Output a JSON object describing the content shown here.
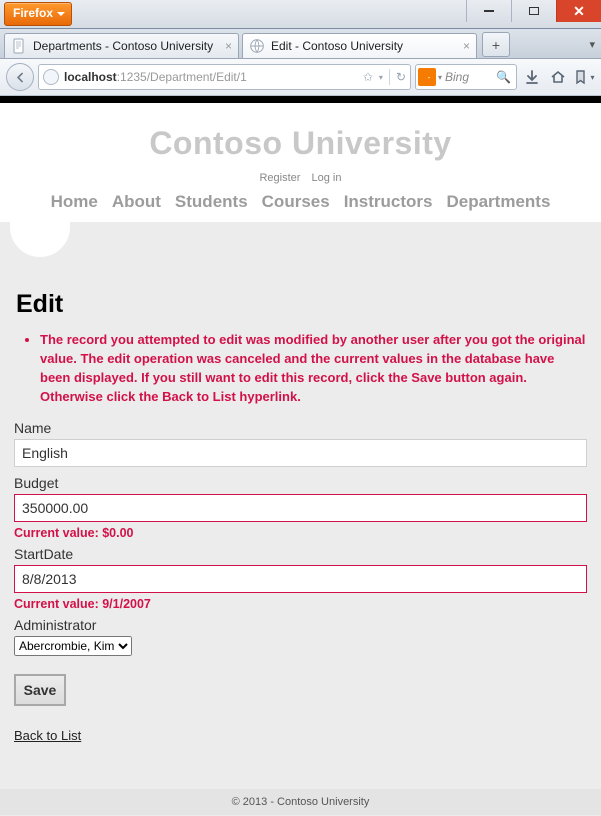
{
  "browser": {
    "app_button_label": "Firefox",
    "tabs": [
      {
        "title": "Departments - Contoso University",
        "active": false
      },
      {
        "title": "Edit - Contoso University",
        "active": true
      }
    ],
    "url_host": "localhost",
    "url_path": ":1235/Department/Edit/1",
    "search_placeholder": "Bing"
  },
  "site": {
    "brand": "Contoso University",
    "auth_links": [
      "Register",
      "Log in"
    ],
    "nav": [
      "Home",
      "About",
      "Students",
      "Courses",
      "Instructors",
      "Departments"
    ],
    "footer": "© 2013 - Contoso University"
  },
  "page": {
    "title": "Edit",
    "validation_summary": "The record you attempted to edit was modified by another user after you got the original value. The edit operation was canceled and the current values in the database have been displayed. If you still want to edit this record, click the Save button again. Otherwise click the Back to List hyperlink.",
    "fields": {
      "name": {
        "label": "Name",
        "value": "English",
        "error": null
      },
      "budget": {
        "label": "Budget",
        "value": "350000.00",
        "error": "Current value: $0.00"
      },
      "startdate": {
        "label": "StartDate",
        "value": "8/8/2013",
        "error": "Current value: 9/1/2007"
      },
      "admin": {
        "label": "Administrator",
        "selected": "Abercrombie, Kim"
      }
    },
    "save_label": "Save",
    "back_label": "Back to List"
  }
}
